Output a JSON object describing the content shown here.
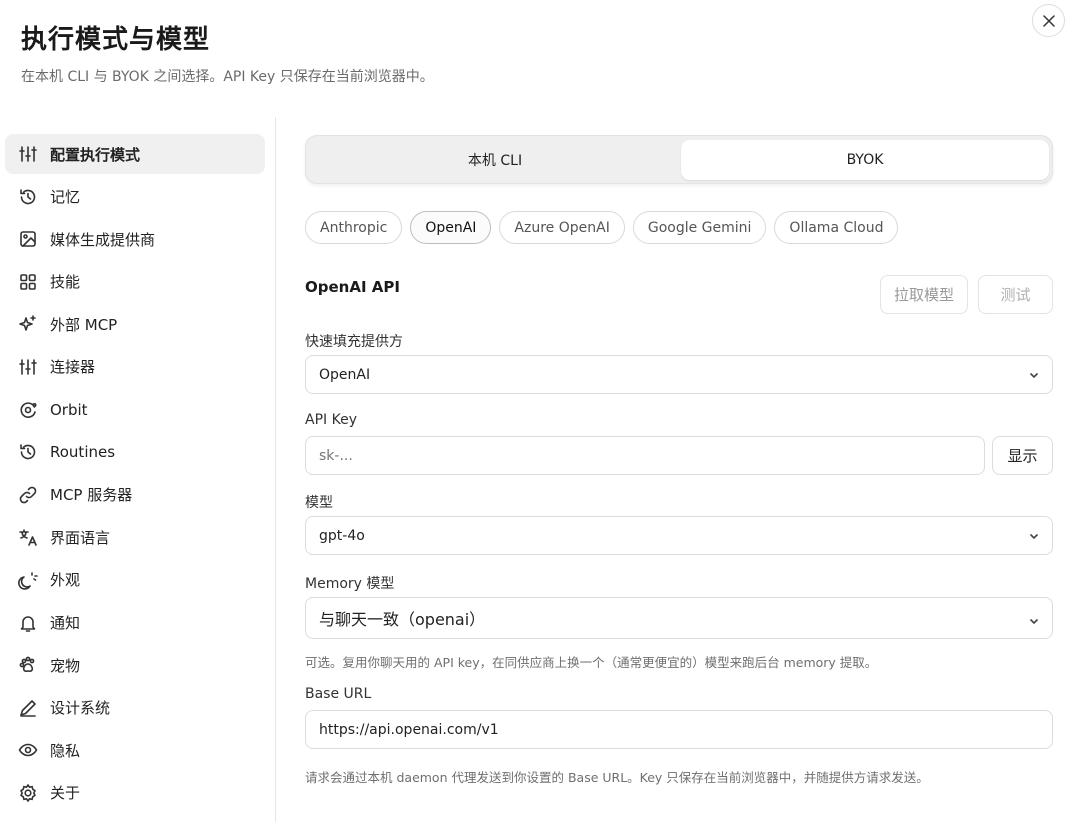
{
  "header": {
    "title": "执行模式与模型",
    "subtitle": "在本机 CLI 与 BYOK 之间选择。API Key 只保存在当前浏览器中。"
  },
  "sidebar": {
    "items": [
      {
        "label": "配置执行模式",
        "icon": "sliders-icon",
        "active": true
      },
      {
        "label": "记忆",
        "icon": "history-icon"
      },
      {
        "label": "媒体生成提供商",
        "icon": "image-icon"
      },
      {
        "label": "技能",
        "icon": "grid-icon"
      },
      {
        "label": "外部 MCP",
        "icon": "sparkle-icon"
      },
      {
        "label": "连接器",
        "icon": "sliders-icon"
      },
      {
        "label": "Orbit",
        "icon": "orbit-icon"
      },
      {
        "label": "Routines",
        "icon": "history-icon"
      },
      {
        "label": "MCP 服务器",
        "icon": "link-icon"
      },
      {
        "label": "界面语言",
        "icon": "translate-icon"
      },
      {
        "label": "外观",
        "icon": "theme-icon"
      },
      {
        "label": "通知",
        "icon": "bell-icon"
      },
      {
        "label": "宠物",
        "icon": "paw-icon"
      },
      {
        "label": "设计系统",
        "icon": "pen-icon"
      },
      {
        "label": "隐私",
        "icon": "eye-icon"
      },
      {
        "label": "关于",
        "icon": "gear-icon"
      }
    ]
  },
  "mode_toggle": {
    "options": [
      "本机 CLI",
      "BYOK"
    ],
    "selected": "BYOK"
  },
  "providers": {
    "chips": [
      "Anthropic",
      "OpenAI",
      "Azure OpenAI",
      "Google Gemini",
      "Ollama Cloud"
    ],
    "selected": "OpenAI"
  },
  "api_section": {
    "title": "OpenAI API",
    "pull_models_label": "拉取模型",
    "test_label": "测试"
  },
  "form": {
    "quick_fill_label": "快速填充提供方",
    "quick_fill_value": "OpenAI",
    "api_key_label": "API Key",
    "api_key_placeholder": "sk-...",
    "show_label": "显示",
    "model_label": "模型",
    "model_value": "gpt-4o",
    "memory_label": "Memory 模型",
    "memory_value": "与聊天一致（openai）",
    "memory_hint": "可选。复用你聊天用的 API key，在同供应商上换一个（通常更便宜的）模型来跑后台 memory 提取。",
    "base_url_label": "Base URL",
    "base_url_value": "https://api.openai.com/v1",
    "base_url_hint": "请求会通过本机 daemon 代理发送到你设置的 Base URL。Key 只保存在当前浏览器中，并随提供方请求发送。"
  }
}
